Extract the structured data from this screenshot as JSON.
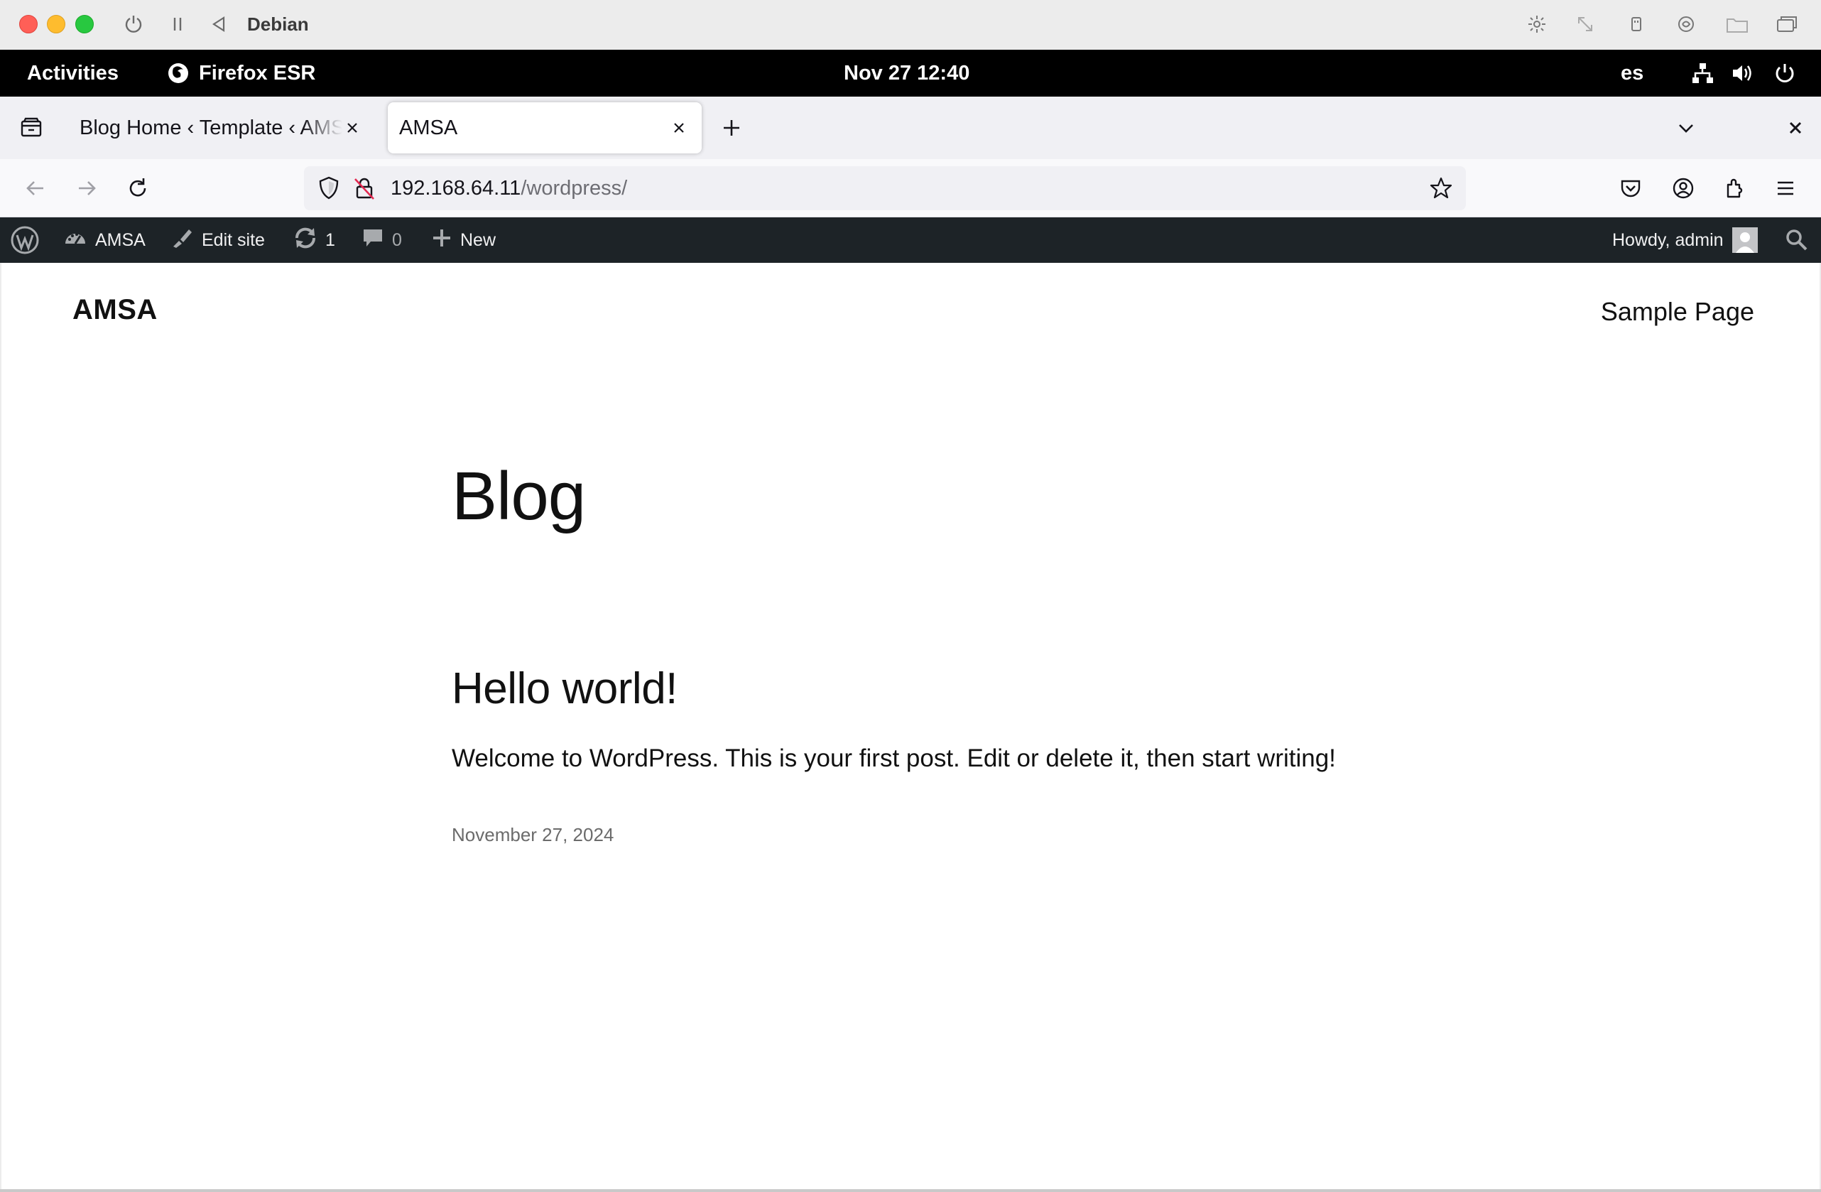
{
  "vm_window": {
    "title": "Debian"
  },
  "gnome_bar": {
    "activities": "Activities",
    "app_name": "Firefox ESR",
    "clock": "Nov 27  12:40",
    "keyboard_layout": "es"
  },
  "browser": {
    "tabs": [
      {
        "label": "Blog Home ‹ Template ‹ AMSA",
        "active": false
      },
      {
        "label": "AMSA",
        "active": true
      }
    ],
    "url": {
      "host": "192.168.64.11",
      "path": "/wordpress/"
    }
  },
  "wp_admin_bar": {
    "site_name": "AMSA",
    "edit_site": "Edit site",
    "updates_count": "1",
    "comments_count": "0",
    "new_label": "New",
    "greeting": "Howdy, admin"
  },
  "site": {
    "title": "AMSA",
    "nav_link": "Sample Page",
    "page_heading": "Blog",
    "post": {
      "title": "Hello world!",
      "excerpt": "Welcome to WordPress. This is your first post. Edit or delete it, then start writing!",
      "date": "November 27, 2024"
    }
  },
  "colors": {
    "wp_admin_bar_bg": "#1d2327",
    "gnome_bar_bg": "#000000",
    "tab_strip_bg": "#f0f0f4"
  }
}
